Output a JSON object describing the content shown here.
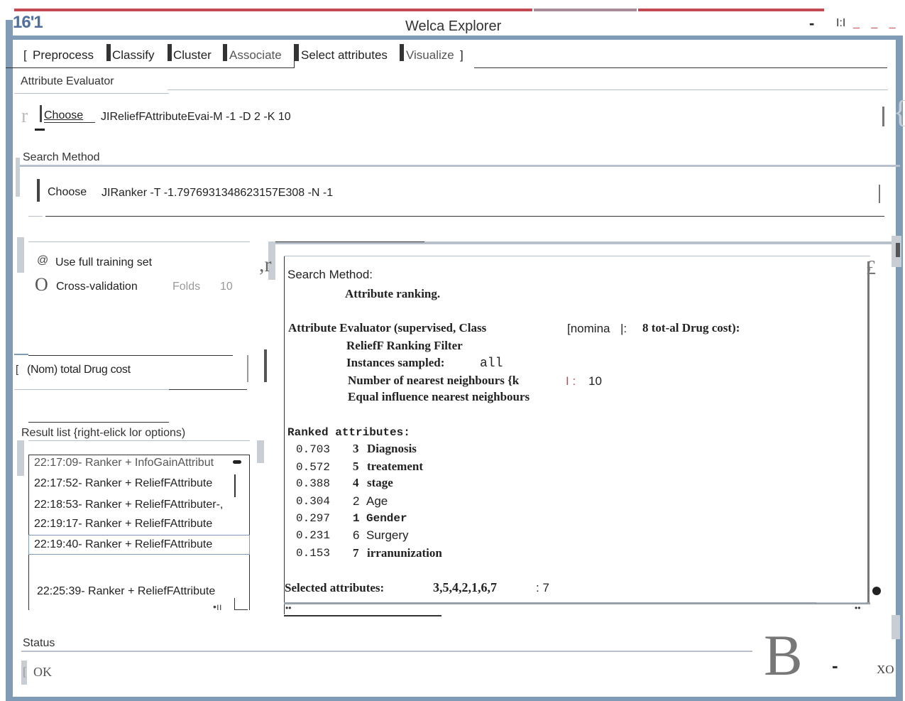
{
  "window": {
    "app_icon_text": "16'1",
    "title": "Welca Explorer",
    "ctrl_minimize": "-",
    "ctrl_maximize": "I:I",
    "ctrl_close": "_ _ _"
  },
  "tabs": {
    "open_bracket": "[",
    "preprocess": "Preprocess",
    "classify": "Classify",
    "cluster": "Cluster",
    "associate": "Associate",
    "select_attributes": "Select attributes",
    "visualize": "Visualize",
    "close_bracket": "]"
  },
  "attribute_evaluator": {
    "section_label": "Attribute Evaluator",
    "choose_label": "Choose",
    "value": "JIReliefFAttributeEvai-M -1 -D 2 -K 10"
  },
  "search_method": {
    "section_label": "Search Method",
    "choose_label": "Choose",
    "value": "JIRanker -T -1.7976931348623157E308 -N -1"
  },
  "options": {
    "full_training_icon": "@",
    "full_training_label": "Use full training set",
    "cross_validation_icon": "O",
    "cross_validation_label": "Cross-validation",
    "folds_label": "Folds",
    "folds_value": "10"
  },
  "class_select": {
    "bracket": "[",
    "value": "(Nom) total Drug cost"
  },
  "result_list": {
    "label": "Result list {right-elick lor options)",
    "items": [
      "22:17:09- Ranker + InfoGainAttribut",
      "22:17:52- Ranker + ReliefFAttribute",
      "22:18:53- Ranker + ReliefFAttributer-,",
      "22:19:17- Ranker + ReliefFAttribute",
      "22:19:40- Ranker + ReliefFAttribute",
      "22:25:39- Ranker + ReliefFAttribute"
    ],
    "scroll_dots": "•ıı"
  },
  "output": {
    "line_search_method": "Search Method:",
    "line_attribute_ranking": "Attribute ranking.",
    "evaluator_line": {
      "prefix": "Attribute Evaluator (supervised, Class",
      "class_kind": "[nomina",
      "class_close": "|:",
      "class_name": "8 tot-al Drug cost):"
    },
    "relief_filter": "ReliefF Ranking Filter",
    "instances_label": "Instances sampled:",
    "instances_value": "all",
    "neighbours_label": "Number of nearest neighbours {k",
    "neighbours_value": "10",
    "neighbours_sep": "I :",
    "equal_influence": "Equal influence nearest neighbours",
    "ranked_header": "Ranked attributes:",
    "ranked": [
      {
        "score": "0.703",
        "index": "3",
        "name": "Diagnosis"
      },
      {
        "score": "0.572",
        "index": "5",
        "name": "treatement"
      },
      {
        "score": "0.388",
        "index": "4",
        "name": "stage"
      },
      {
        "score": "0.304",
        "index": "2",
        "name": "Age"
      },
      {
        "score": "0.297",
        "index": "1",
        "name": "Gender"
      },
      {
        "score": "0.231",
        "index": "6",
        "name": "Surgery"
      },
      {
        "score": "0.153",
        "index": "7",
        "name": "irranunization"
      }
    ],
    "selected_label": "Selected attributes:",
    "selected_values": "3,5,4,2,1,6,7",
    "selected_count": ": 7",
    "corner_glyph": "£",
    "bottom_left_dots": "••",
    "bottom_right_dots": "••"
  },
  "status": {
    "label": "Status",
    "bracket": "[",
    "text": "OK",
    "big_glyph": "B",
    "dash": "-",
    "right_text": "XO"
  },
  "stray": {
    "glyph_r": "r",
    "glyph_comma_r": ",r",
    "glyph_bracket": "[",
    "glyph_i": "I",
    "glyph_brace": "{"
  }
}
